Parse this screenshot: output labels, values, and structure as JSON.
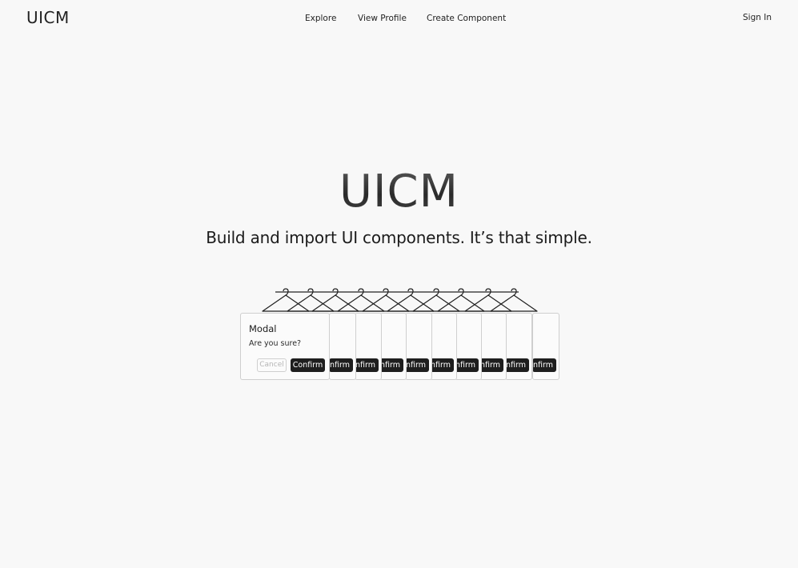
{
  "header": {
    "logo": "UICM",
    "nav": {
      "explore": "Explore",
      "view_profile": "View Profile",
      "create_component": "Create Component"
    },
    "sign_in": "Sign In"
  },
  "hero": {
    "title": "UICM",
    "subtitle": "Build and import UI components. It’s that simple."
  },
  "showcase": {
    "modal": {
      "title": "Modal",
      "body": "Are you sure?",
      "cancel_label": "Cancel",
      "confirm_label": "Confirm"
    },
    "stacked_fragment_label": "nfirm",
    "stacked_count": 9
  },
  "colors": {
    "background": "#f8f8f8",
    "text": "#1c1c1c",
    "button_dark": "#1e1e1e",
    "border": "#cfcfcf"
  }
}
